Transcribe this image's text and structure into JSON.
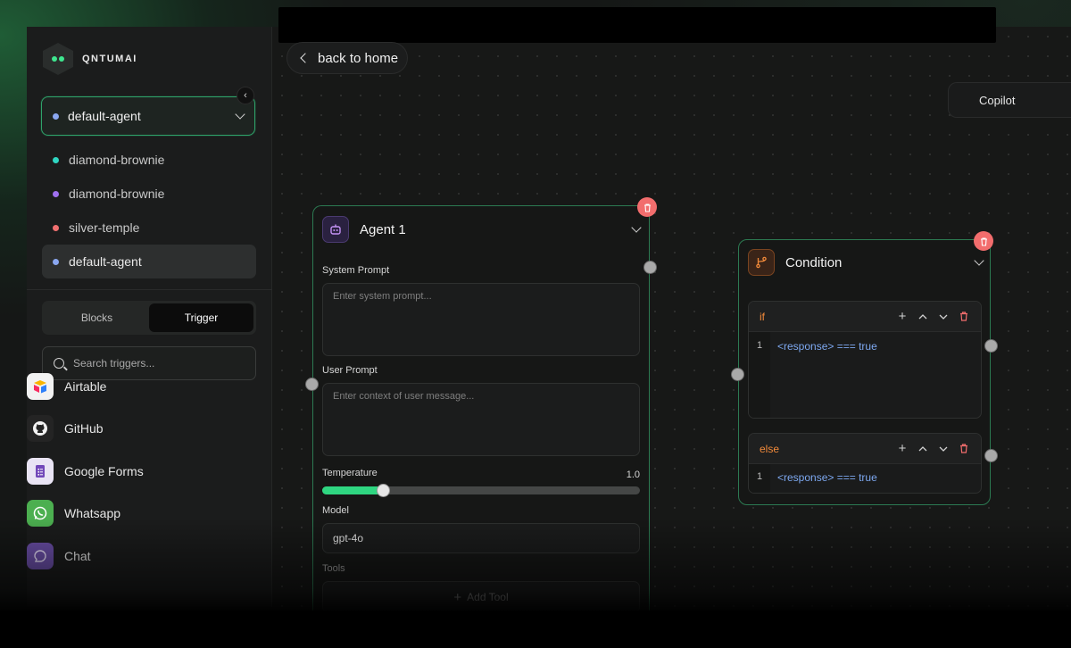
{
  "app": {
    "brand": "QNTUMAI"
  },
  "header": {
    "back_label": "back to home",
    "copilot_label": "Copilot"
  },
  "sidebar": {
    "selected_agent": {
      "label": "default-agent",
      "color": "#8aa7f0"
    },
    "agents": [
      {
        "label": "diamond-brownie",
        "color": "#2fd6c2"
      },
      {
        "label": "diamond-brownie",
        "color": "#a070f0"
      },
      {
        "label": "silver-temple",
        "color": "#f07070"
      },
      {
        "label": "default-agent",
        "color": "#8aa7f0"
      }
    ],
    "tabs": [
      {
        "label": "Blocks"
      },
      {
        "label": "Trigger"
      }
    ],
    "search_placeholder": "Search triggers...",
    "triggers": [
      {
        "label": "Airtable",
        "icon": "airtable-icon"
      },
      {
        "label": "GitHub",
        "icon": "github-icon"
      },
      {
        "label": "Google Forms",
        "icon": "google-forms-icon"
      },
      {
        "label": "Whatsapp",
        "icon": "whatsapp-icon"
      },
      {
        "label": "Chat",
        "icon": "chat-icon"
      }
    ]
  },
  "agent_node": {
    "title": "Agent 1",
    "system_prompt_label": "System Prompt",
    "system_prompt_placeholder": "Enter system prompt...",
    "user_prompt_label": "User Prompt",
    "user_prompt_placeholder": "Enter context of user message...",
    "temperature_label": "Temperature",
    "temperature_value": "1.0",
    "temperature_fraction": 0.19,
    "model_label": "Model",
    "model_value": "gpt-4o",
    "tools_label": "Tools",
    "add_tool_label": "Add Tool"
  },
  "condition_node": {
    "title": "Condition",
    "branches": [
      {
        "name": "if",
        "line": "1",
        "code": "<response> === true"
      },
      {
        "name": "else",
        "line": "1",
        "code": "<response> === true"
      }
    ]
  },
  "colors": {
    "accent": "#2fd681",
    "border_active": "#2c7a52",
    "delete": "#f26d6d",
    "keyword": "#f28a3a",
    "code": "#7da8f0"
  }
}
